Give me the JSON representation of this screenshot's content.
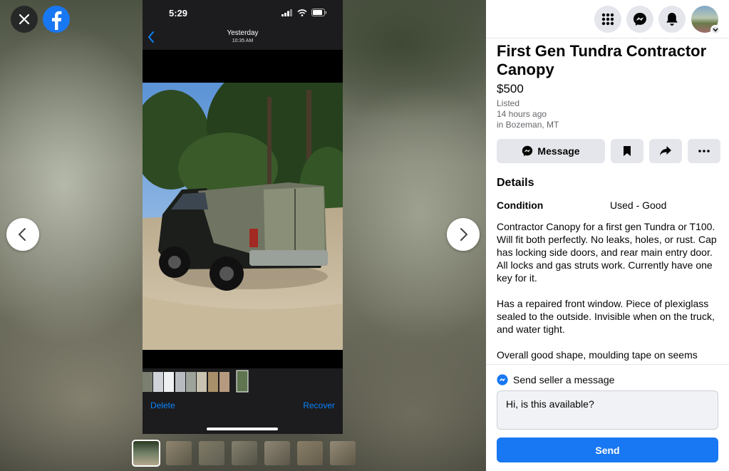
{
  "phone": {
    "time": "5:29",
    "header_date": "Yesterday",
    "header_time": "10:35 AM",
    "delete_label": "Delete",
    "recover_label": "Recover"
  },
  "listing": {
    "title": "First Gen Tundra Contractor Canopy",
    "price": "$500",
    "listed": "Listed",
    "listed_ago": "14 hours ago",
    "location": "in Bozeman, MT",
    "message_button": "Message",
    "details_heading": "Details",
    "condition_label": "Condition",
    "condition_value": "Used - Good",
    "description": [
      "Contractor Canopy for a first gen Tundra or T100. Will fit both perfectly. No leaks, holes, or rust. Cap has locking side doors, and rear main entry door. All locks and gas struts work. Currently have one key for it.",
      "Has a repaired front window. Piece of plexiglass sealed to the outside. Invisible when on the truck, and water tight.",
      "Overall good shape, moulding tape on seems"
    ]
  },
  "message": {
    "heading": "Send seller a message",
    "input_value": "Hi, is this available?",
    "send_label": "Send"
  },
  "colors": {
    "facebook_blue": "#1877f2",
    "ios_blue": "#0a84ff",
    "button_gray": "#e4e6eb"
  },
  "icons": [
    "close-icon",
    "facebook-logo",
    "chevron-left-icon",
    "chevron-right-icon",
    "menu-grid-icon",
    "messenger-icon",
    "bell-icon",
    "bookmark-icon",
    "share-icon",
    "more-icon"
  ]
}
